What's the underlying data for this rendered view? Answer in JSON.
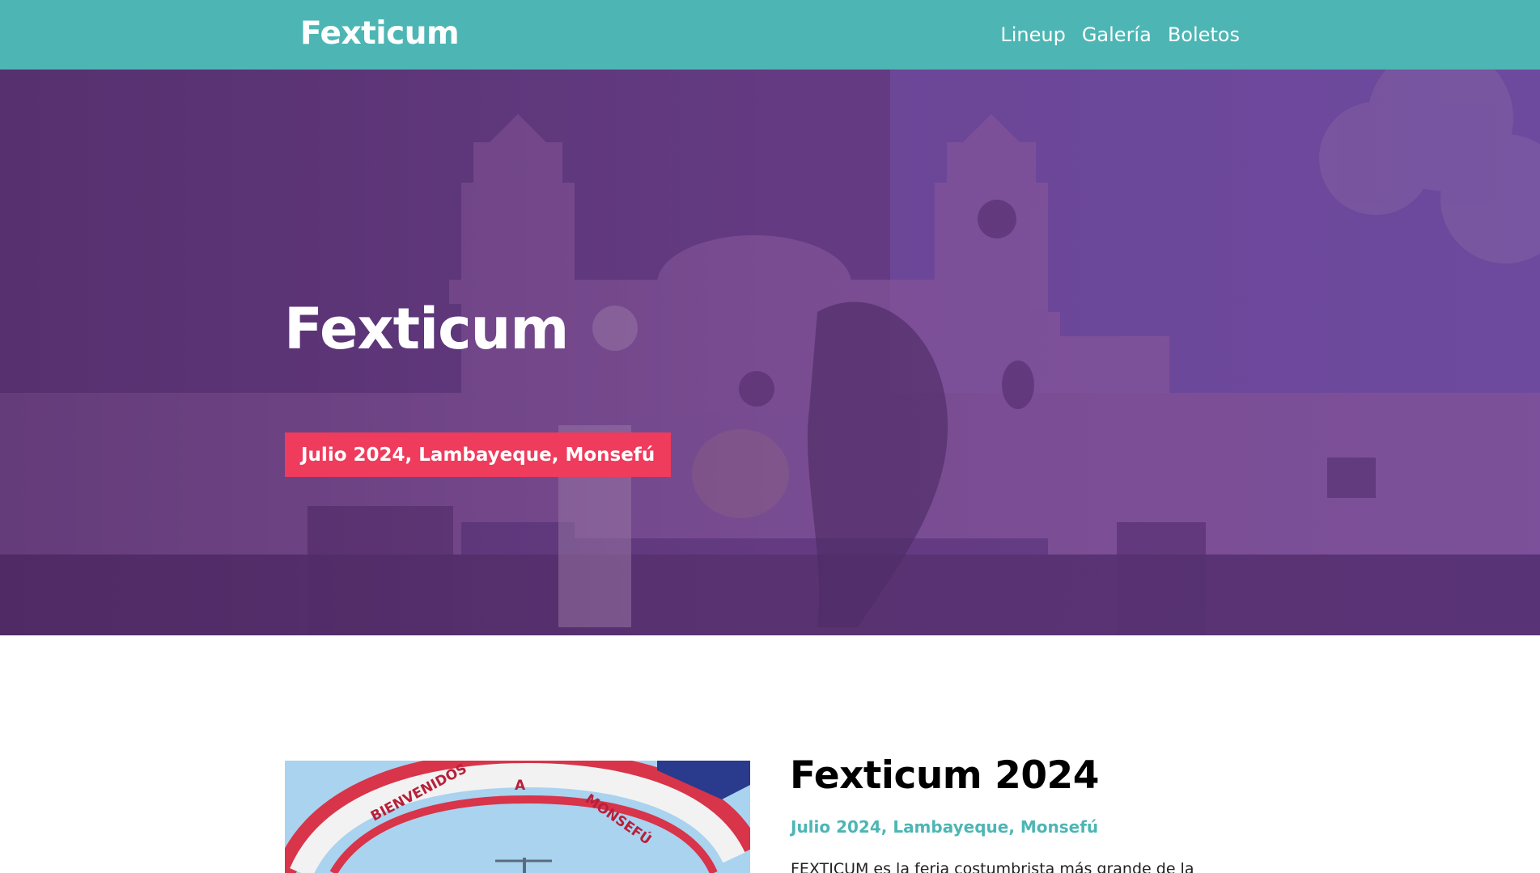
{
  "header": {
    "logo": "Fexticum",
    "nav": [
      {
        "label": "Lineup"
      },
      {
        "label": "Galería"
      },
      {
        "label": "Boletos"
      }
    ]
  },
  "hero": {
    "title": "Fexticum",
    "badge": "Julio 2024, Lambayeque, Monsefú"
  },
  "about": {
    "title": "Fexticum 2024",
    "subtitle": "Julio 2024, Lambayeque, Monsefú",
    "text": "FEXTICUM es la feria costumbrista más grande de la",
    "image_arch_text": "BIENVENIDOS A MONSEFÚ"
  },
  "colors": {
    "header_bg": "#4db6b4",
    "accent_red": "#ef3b5c",
    "accent_teal": "#4db6b4",
    "hero_tint": "#5a3878"
  }
}
